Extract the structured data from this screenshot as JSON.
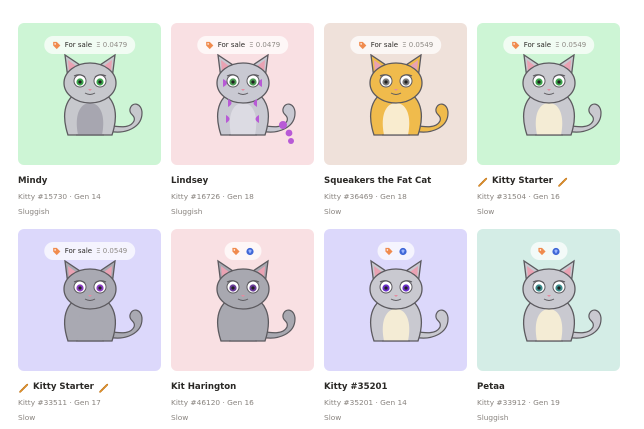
{
  "kitties": [
    {
      "name": "Mindy",
      "id_gen": "Kitty #15730 · Gen 14",
      "speed": "Sluggish",
      "sale_label": "For sale",
      "sale_price": "Ξ 0.0479",
      "bg": "#cdf5d5",
      "body": "#c7c8cd",
      "belly": "#a7a6b0",
      "stripe": "#c7c8cd",
      "eye": "#3aa44a",
      "starter": false
    },
    {
      "name": "Lindsey",
      "id_gen": "Kitty #16726 · Gen 18",
      "speed": "Sluggish",
      "sale_label": "For sale",
      "sale_price": "Ξ 0.0479",
      "bg": "#f9e0e3",
      "body": "#c9c9d2",
      "belly": "#dcdbe3",
      "stripe": "#b85ad6",
      "eye": "#4a9a52",
      "starter": false
    },
    {
      "name": "Squeakers the Fat Cat",
      "id_gen": "Kitty #36469 · Gen 18",
      "speed": "Slow",
      "sale_label": "For sale",
      "sale_price": "Ξ 0.0549",
      "bg": "#efe1da",
      "body": "#f0bb4c",
      "belly": "#f9eccf",
      "stripe": "#f0bb4c",
      "eye": "#7a7a7a",
      "starter": false
    },
    {
      "name": "Kitty Starter",
      "id_gen": "Kitty #31504 · Gen 16",
      "speed": "Slow",
      "sale_label": "For sale",
      "sale_price": "Ξ 0.0549",
      "bg": "#cdf5d5",
      "body": "#c9c9cf",
      "belly": "#f4ecd5",
      "stripe": "#c9c9cf",
      "eye": "#3aa44a",
      "starter": true
    },
    {
      "name": "Kitty Starter",
      "id_gen": "Kitty #33511 · Gen 17",
      "speed": "Slow",
      "sale_label": "For sale",
      "sale_price": "Ξ 0.0549",
      "bg": "#dcd8fb",
      "body": "#a9a9b2",
      "belly": "#a9a9b2",
      "stripe": "#a9a9b2",
      "eye": "#8b3dc2",
      "starter": true
    },
    {
      "name": "Kit Harington",
      "id_gen": "Kitty #46120 · Gen 16",
      "speed": "Slow",
      "sale_label": "",
      "sale_price": "",
      "bg": "#f9e0e3",
      "body": "#a8a8b0",
      "belly": "#a8a8b0",
      "stripe": "#a8a8b0",
      "eye": "#6b3c9a",
      "starter": false
    },
    {
      "name": "Kitty #35201",
      "id_gen": "Kitty #35201 · Gen 14",
      "speed": "Slow",
      "sale_label": "",
      "sale_price": "",
      "bg": "#dcd8fb",
      "body": "#c9c9d0",
      "belly": "#f4ecd5",
      "stripe": "#c9c9d0",
      "eye": "#6a2ec9",
      "starter": false
    },
    {
      "name": "Petaa",
      "id_gen": "Kitty #33912 · Gen 19",
      "speed": "Sluggish",
      "sale_label": "",
      "sale_price": "",
      "bg": "#d4ede6",
      "body": "#c9c9d0",
      "belly": "#f4ecd5",
      "stripe": "#c9c9d0",
      "eye": "#3a8a8a",
      "starter": false
    }
  ]
}
